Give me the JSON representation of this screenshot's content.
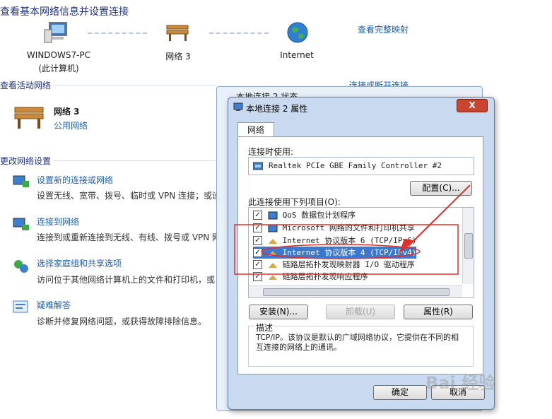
{
  "page": {
    "title": "查看基本网络信息并设置连接",
    "view_full_map": "查看完整映射",
    "nodes": [
      {
        "label": "WINDOWS7-PC",
        "sub": "(此计算机)"
      },
      {
        "label": "网络  3",
        "sub": ""
      },
      {
        "label": "Internet",
        "sub": ""
      }
    ],
    "active_networks_label": "查看活动网络",
    "connect_or_disconnect": "连接或断开连接",
    "active_network": {
      "name": "网络  3",
      "type": "公用网络"
    },
    "change_settings_label": "更改网络设置",
    "tasks": [
      {
        "title": "设置新的连接或网络",
        "desc": "设置无线、宽带、拨号、临时或 VPN 连接；或设"
      },
      {
        "title": "连接到网络",
        "desc": "连接到或重新连接到无线、有线、拨号或 VPN 网"
      },
      {
        "title": "选择家庭组和共享选项",
        "desc": "访问位于其他网络计算机上的文件和打印机，或"
      },
      {
        "title": "疑难解答",
        "desc": "诊断并修复网络问题，或获得故障排除信息。"
      }
    ]
  },
  "bg_window": {
    "title": "本地连接 2 状态"
  },
  "dialog": {
    "title": "本地连接 2 属性",
    "tab": "网络",
    "connect_using_label": "连接时使用:",
    "adapter": "Realtek PCIe GBE Family Controller #2",
    "configure_btn": "配置(C)...",
    "items_label": "此连接使用下列项目(O):",
    "items": [
      {
        "label": "QoS 数据包计划程序",
        "checked": true
      },
      {
        "label": "Microsoft 网络的文件和打印机共享",
        "checked": true
      },
      {
        "label": "Internet 协议版本 6 (TCP/IPv6)",
        "checked": true
      },
      {
        "label": "Internet 协议版本 4 (TCP/IPv4)",
        "checked": true
      },
      {
        "label": "链路层拓扑发现映射器 I/O 驱动程序",
        "checked": true
      },
      {
        "label": "链路层拓扑发现响应程序",
        "checked": true
      }
    ],
    "install_btn": "安装(N)...",
    "uninstall_btn": "卸载(U)",
    "properties_btn": "属性(R)",
    "description_label": "描述",
    "description": "TCP/IP。该协议是默认的广域网络协议，它提供在不同的相互连接的网络上的通讯。",
    "ok_btn": "确定",
    "cancel_btn": "取消",
    "close_glyph": "X"
  },
  "watermark": "Bai 经验",
  "colors": {
    "link": "#1c5fb6",
    "selection": "#3b78d0",
    "annotation_red": "#e0302a"
  }
}
